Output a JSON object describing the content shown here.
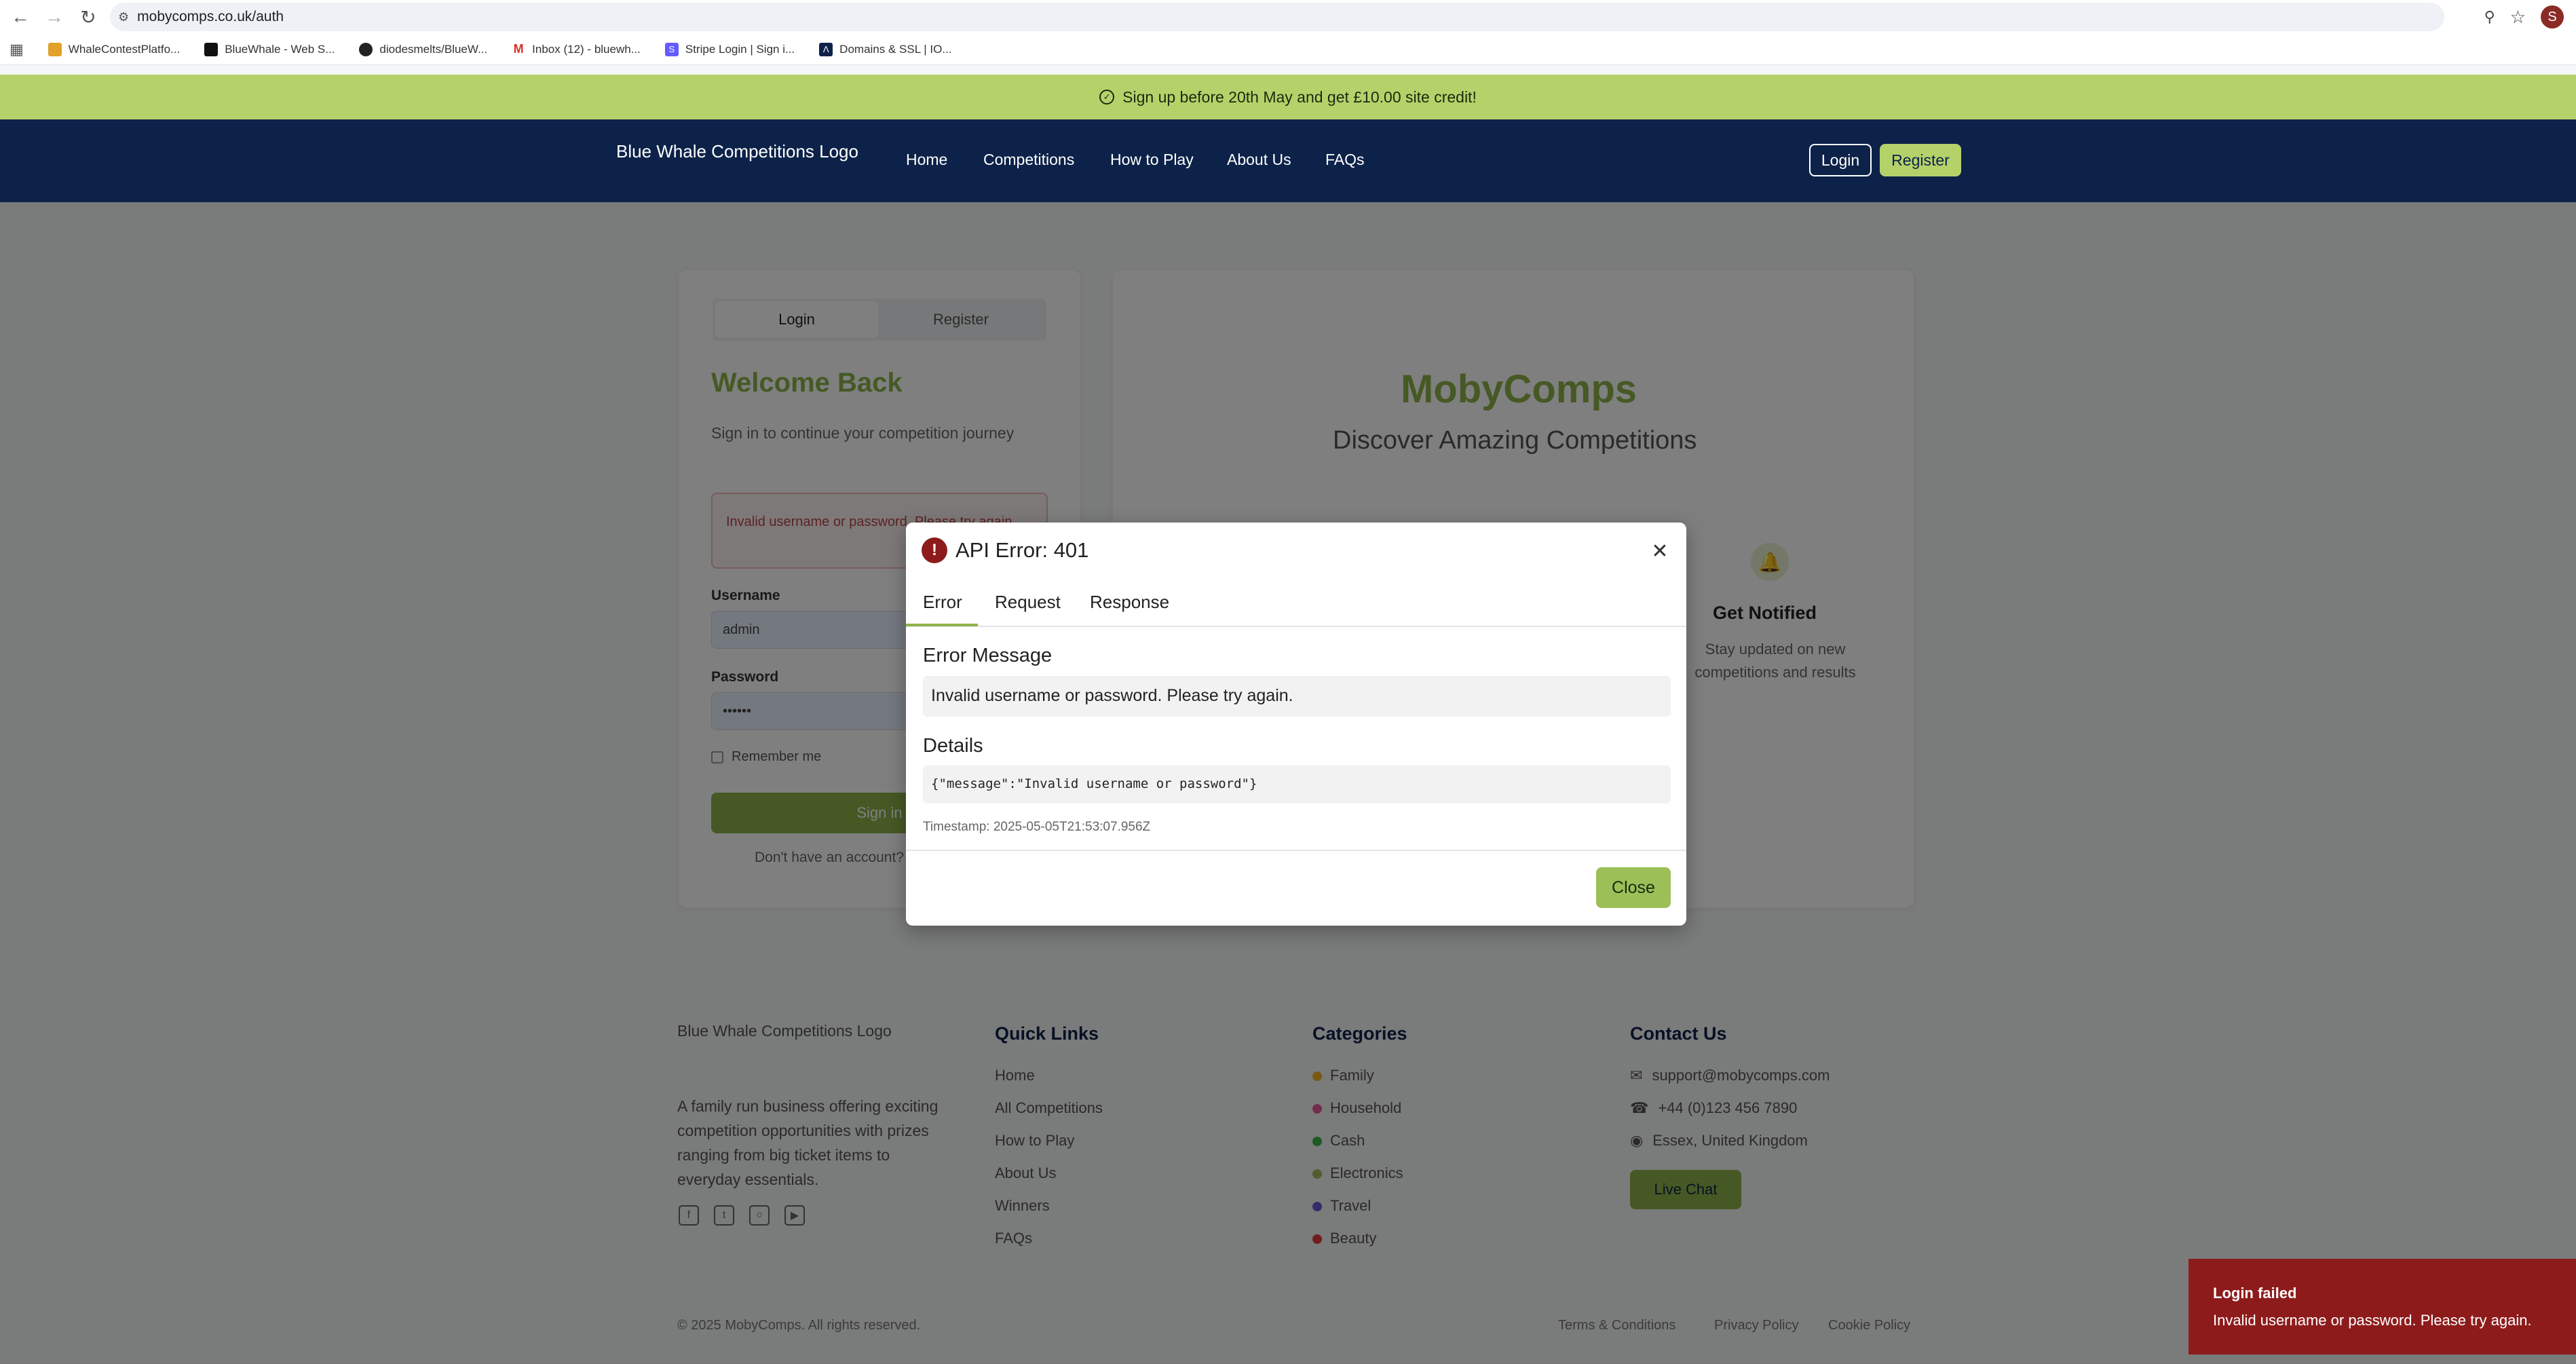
{
  "browser": {
    "url": "mobycomps.co.uk/auth",
    "profile_initial": "S",
    "bookmarks": [
      {
        "label": "WhaleContestPlatfo...",
        "color": "#e1a12a"
      },
      {
        "label": "BlueWhale - Web S...",
        "color": "#111111"
      },
      {
        "label": "diodesmelts/BlueW...",
        "color": "#222222"
      },
      {
        "label": "Inbox (12) - bluewh...",
        "color": "#d93025"
      },
      {
        "label": "Stripe Login | Sign i...",
        "color": "#635bff"
      },
      {
        "label": "Domains & SSL | IO...",
        "color": "#0d2249"
      }
    ]
  },
  "promo": {
    "text": "Sign up before 20th May and get £10.00 site credit!"
  },
  "nav": {
    "logo_alt": "Blue Whale Competitions Logo",
    "links": [
      "Home",
      "Competitions",
      "How to Play",
      "About Us",
      "FAQs"
    ],
    "login": "Login",
    "register": "Register"
  },
  "login_card": {
    "tab_login": "Login",
    "tab_register": "Register",
    "title": "Welcome Back",
    "subtitle": "Sign in to continue your competition journey",
    "error": "Invalid username or password. Please try again.",
    "username_label": "Username",
    "username_value": "admin",
    "password_label": "Password",
    "password_value": "••••••",
    "remember": "Remember me",
    "signin": "Sign in",
    "no_account": "Don't have an account?"
  },
  "hero": {
    "brand": "MobyComps",
    "tagline": "Discover Amazing Competitions",
    "feature_title": "Get Notified",
    "feature_desc": "Stay updated on new competitions and results"
  },
  "footer": {
    "logo_alt": "Blue Whale Competitions Logo",
    "description": "A family run business offering exciting competition opportunities with prizes ranging from big ticket items to everyday essentials.",
    "quick_links_title": "Quick Links",
    "quick_links": [
      "Home",
      "All Competitions",
      "How to Play",
      "About Us",
      "Winners",
      "FAQs"
    ],
    "categories_title": "Categories",
    "categories": [
      {
        "label": "Family",
        "color": "#f0b323"
      },
      {
        "label": "Household",
        "color": "#e45a9b"
      },
      {
        "label": "Cash",
        "color": "#3bb34a"
      },
      {
        "label": "Electronics",
        "color": "#9cbf58"
      },
      {
        "label": "Travel",
        "color": "#6b5bd6"
      },
      {
        "label": "Beauty",
        "color": "#e23b3b"
      }
    ],
    "contact_title": "Contact Us",
    "email": "support@mobycomps.com",
    "phone": "+44 (0)123 456 7890",
    "location": "Essex, United Kingdom",
    "live_chat": "Live Chat",
    "copyright": "© 2025 MobyComps. All rights reserved.",
    "legal": [
      "Terms & Conditions",
      "Privacy Policy",
      "Cookie Policy"
    ]
  },
  "modal": {
    "title": "API Error: 401",
    "tabs": [
      "Error",
      "Request",
      "Response"
    ],
    "error_message_heading": "Error Message",
    "error_message": "Invalid username or password. Please try again.",
    "details_heading": "Details",
    "details": "{\"message\":\"Invalid username or password\"}",
    "timestamp": "Timestamp: 2025-05-05T21:53:07.956Z",
    "close": "Close"
  },
  "toast": {
    "title": "Login failed",
    "message": "Invalid username or password. Please try again."
  }
}
